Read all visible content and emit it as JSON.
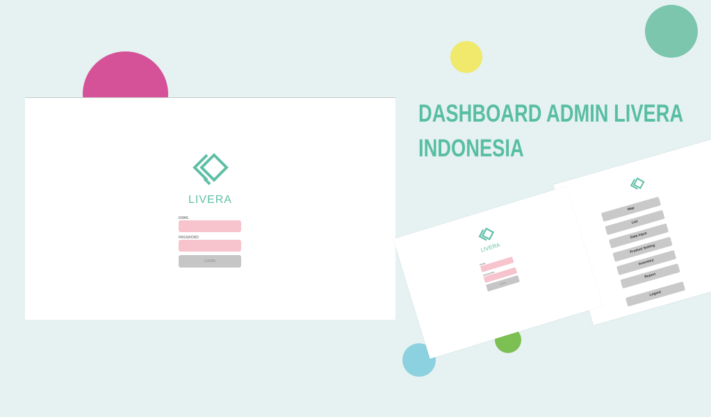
{
  "headline": {
    "line1": "DASHBOARD ADMIN LIVERA",
    "line2": "INDONESIA"
  },
  "login": {
    "brand": "LIVERA",
    "email_label": "EMAIL",
    "password_label": "PASSWORD",
    "login_button": "LOGIN"
  },
  "menu": {
    "items": [
      "Map",
      "List",
      "Data Input",
      "Product Setting",
      "Inventory",
      "Report"
    ],
    "logout": "Logout"
  },
  "colors": {
    "background": "#e6f1f1",
    "accent_teal": "#58bea3",
    "circle_pink": "#d55298",
    "circle_yellow": "#f0e96b",
    "circle_teal": "#7bc6ad",
    "circle_blue": "#8cd1e0",
    "circle_green": "#7cbf52",
    "input_pink": "#f7c3cd",
    "button_gray": "#c6c6c6"
  },
  "icons": {
    "logo": "livera-diamond-logo"
  }
}
